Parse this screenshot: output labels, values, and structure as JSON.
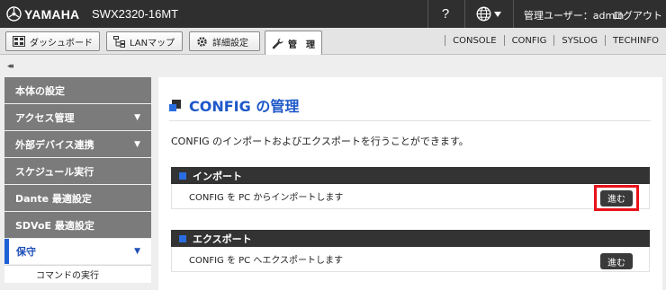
{
  "header": {
    "brand": "YAMAHA",
    "model": "SWX2320-16MT",
    "help_label": "?",
    "user": "管理ユーザー：admin",
    "logout": "ログアウト"
  },
  "tabs": [
    {
      "label": "ダッシュボード",
      "icon": "dashboard-icon"
    },
    {
      "label": "LANマップ",
      "icon": "lan-map-icon"
    },
    {
      "label": "詳細設定",
      "icon": "gear-icon"
    },
    {
      "label": "管　理",
      "icon": "wrench-icon",
      "active": true
    }
  ],
  "ext_links": [
    "CONSOLE",
    "CONFIG",
    "SYSLOG",
    "TECHINFO"
  ],
  "collapse_label": "◂◂",
  "sidebar": {
    "items": [
      {
        "label": "本体の設定",
        "arrow": ""
      },
      {
        "label": "アクセス管理",
        "arrow": "▼"
      },
      {
        "label": "外部デバイス連携",
        "arrow": "▼"
      },
      {
        "label": "スケジュール実行",
        "arrow": ""
      },
      {
        "label": "Dante 最適設定",
        "arrow": ""
      },
      {
        "label": "SDVoE 最適設定",
        "arrow": ""
      },
      {
        "label": "保守",
        "arrow": "▼",
        "active": true
      }
    ],
    "sub_items": [
      "コマンドの実行"
    ]
  },
  "main": {
    "title": "CONFIG の管理",
    "description": "CONFIG のインポートおよびエクスポートを行うことができます。",
    "import": {
      "heading": "インポート",
      "text": "CONFIG を PC からインポートします",
      "button": "進む"
    },
    "export": {
      "heading": "エクスポート",
      "text": "CONFIG を PC へエクスポートします",
      "button": "進む"
    }
  },
  "colors": {
    "accent": "#1e58c9",
    "header_bg": "#2f2f2f",
    "section_bg": "#333333",
    "highlight": "#e8121a"
  }
}
